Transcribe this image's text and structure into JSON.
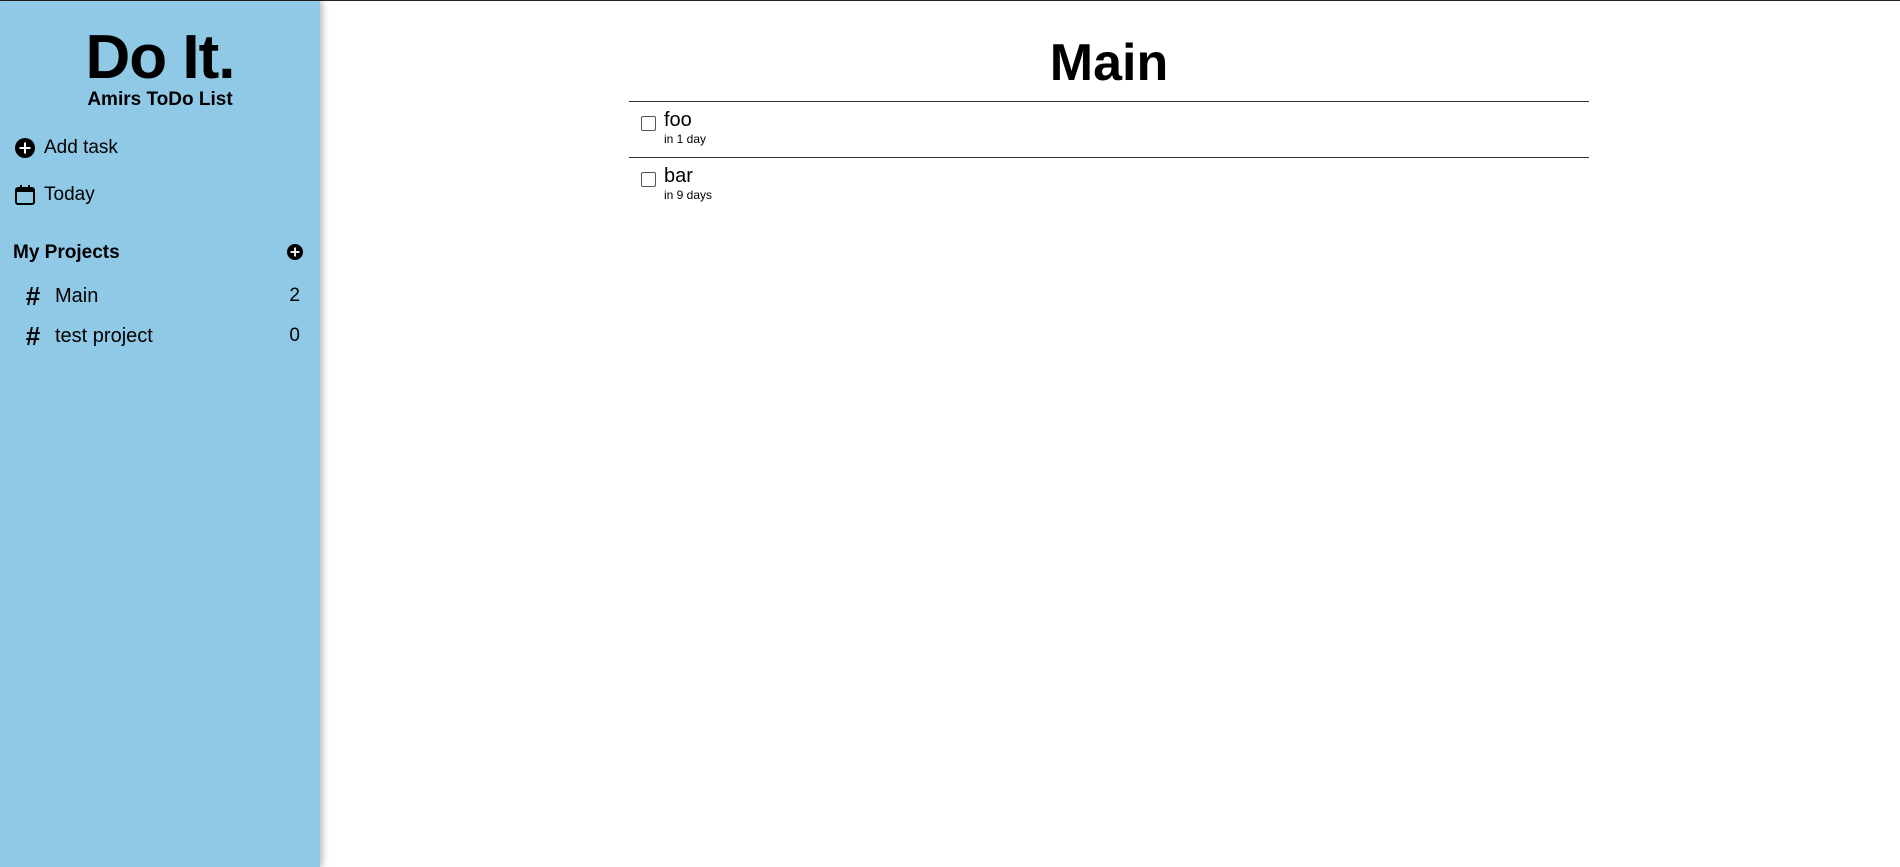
{
  "sidebar": {
    "brand_title": "Do It.",
    "brand_subtitle": "Amirs ToDo List",
    "nav": {
      "add_task": {
        "label": "Add task",
        "icon": "plus-circle-icon"
      },
      "today": {
        "label": "Today",
        "icon": "calendar-icon"
      }
    },
    "projects": {
      "header": "My Projects",
      "add_icon": "plus-circle-icon",
      "items": [
        {
          "name": "Main",
          "count": "2",
          "icon": "#"
        },
        {
          "name": "test project",
          "count": "0",
          "icon": "#"
        }
      ]
    }
  },
  "main": {
    "title": "Main",
    "tasks": [
      {
        "name": "foo",
        "due": "in 1 day",
        "done": false
      },
      {
        "name": "bar",
        "due": "in 9 days",
        "done": false
      }
    ]
  },
  "colors": {
    "sidebar_bg": "#90c9e6",
    "text": "#000000",
    "divider": "#333333"
  }
}
